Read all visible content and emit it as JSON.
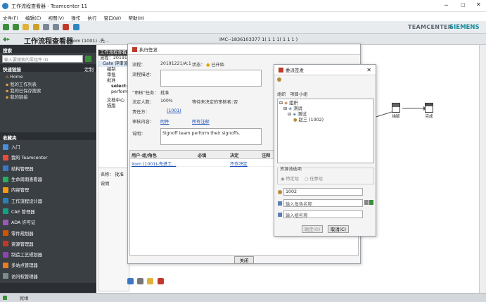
{
  "window": {
    "title": "工作流程查看器 - Teamcenter 11"
  },
  "menu": [
    "文件(F)",
    "编辑(E)",
    "视图(V)",
    "操作",
    "执行",
    "窗口(W)",
    "帮助(H)"
  ],
  "brand": {
    "left": "TEAMCENTER",
    "right": "SIEMENS"
  },
  "app_header": {
    "title": "工作流程查看器",
    "context": "( Xom (1001) -先...",
    "context_tail": "IMC--1836103377 1( 1 1 1( 1 1 1 )"
  },
  "left_panel": {
    "search_header": "搜索",
    "search_placeholder": "输入要搜索的零组件 ID",
    "quick_links_header": "快速链接",
    "quick_links_action": "定制",
    "quick_links": [
      "Home",
      "我的工作列表",
      "我的已保存搜索",
      "我的链接"
    ],
    "favorites_header": "收藏夹",
    "apps": [
      "入门",
      "我的 Teamcenter",
      "结构管理器",
      "生命周期查看器",
      "内容管理",
      "工作流程设计器",
      "CAE 管理器",
      "ADA 许可证",
      "零件规划器",
      "资源管理器",
      "制造工艺规划器",
      "多站点管理器",
      "访问权管理器"
    ],
    "app_colors": [
      "#4a90d9",
      "#e74c3c",
      "#3b78c2",
      "#27ae60",
      "#f39c12",
      "#2980b9",
      "#16a085",
      "#9b59b6",
      "#d35400",
      "#c0392b",
      "#8e44ad",
      "#e67e22",
      "#7f8c8d"
    ]
  },
  "status_bar": {
    "text": "就绪"
  },
  "process_view": {
    "tree_title": "工作流程查看器",
    "process_label": "流程：20191221",
    "tree_items": [
      "Gate 评审流程",
      "编制",
      "审批",
      "批准",
      "select-...",
      "perform-...",
      "文档中心",
      "描版"
    ],
    "name_label": "名称：",
    "name_value": "批准",
    "desc_label": "说明"
  },
  "perform_dialog": {
    "title": "执行签发",
    "process_label": "流程：",
    "process_value": "20191221/A;1",
    "state_label": "状态：",
    "state_value": "已开始",
    "desc_label": "流程描述：",
    "task_label": "“审核”任务：",
    "task_value": "批准",
    "quorum_label": "法定人数：",
    "quorum_value": "100%",
    "wait_label": "等待未决定的审核者：",
    "wait_value": "否",
    "responsible_label": "责任方：",
    "responsible_value": "(1001)",
    "review_label": "审核内容：",
    "attach_link": "附件",
    "all_comments_link": "所有注释",
    "notes_label": "说明：",
    "notes_value": "Signoff team perform their signoffs.",
    "table_headers": [
      "用户-组/角色",
      "必填",
      "决定",
      "注释"
    ],
    "table_rows": [
      {
        "user": "Xom (1001)-先进工...",
        "required": "",
        "decision": "不作决定",
        "comment": ""
      }
    ],
    "close_button": "关闭"
  },
  "delegate_dialog": {
    "title": "委派签发",
    "tabs": [
      "组织",
      "项目小组"
    ],
    "tree": [
      "组织",
      "测试",
      "测试",
      "赵三 (1002)"
    ],
    "pool_header": "资源池选项",
    "radio_specific": "特定组",
    "radio_any": "任意组",
    "user_value": "1002",
    "role_placeholder": "输入角色名称",
    "group_placeholder": "输入组名称",
    "ok_button": "确定(O)",
    "cancel_button": "取消(C)"
  },
  "canvas": {
    "node1_label": "描版",
    "node2_label": "完成"
  }
}
